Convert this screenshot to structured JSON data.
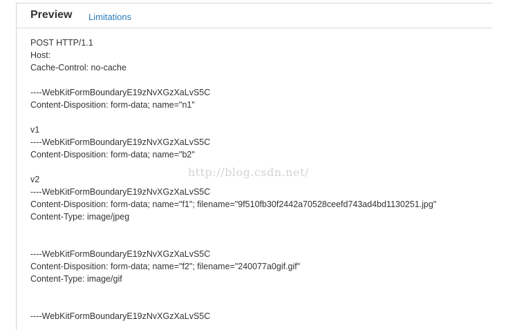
{
  "tabs": {
    "preview_label": "Preview",
    "limitations_label": "Limitations"
  },
  "request": {
    "lines": [
      "POST HTTP/1.1",
      "Host:",
      "Cache-Control: no-cache",
      "",
      "----WebKitFormBoundaryE19zNvXGzXaLvS5C",
      "Content-Disposition: form-data; name=\"n1\"",
      "",
      "v1",
      "----WebKitFormBoundaryE19zNvXGzXaLvS5C",
      "Content-Disposition: form-data; name=\"b2\"",
      "",
      "v2",
      "----WebKitFormBoundaryE19zNvXGzXaLvS5C",
      "Content-Disposition: form-data; name=\"f1\"; filename=\"9f510fb30f2442a70528ceefd743ad4bd1130251.jpg\"",
      "Content-Type: image/jpeg",
      "",
      "",
      "----WebKitFormBoundaryE19zNvXGzXaLvS5C",
      "Content-Disposition: form-data; name=\"f2\"; filename=\"240077a0gif.gif\"",
      "Content-Type: image/gif",
      "",
      "",
      "----WebKitFormBoundaryE19zNvXGzXaLvS5C"
    ]
  },
  "watermark": "http://blog.csdn.net/"
}
